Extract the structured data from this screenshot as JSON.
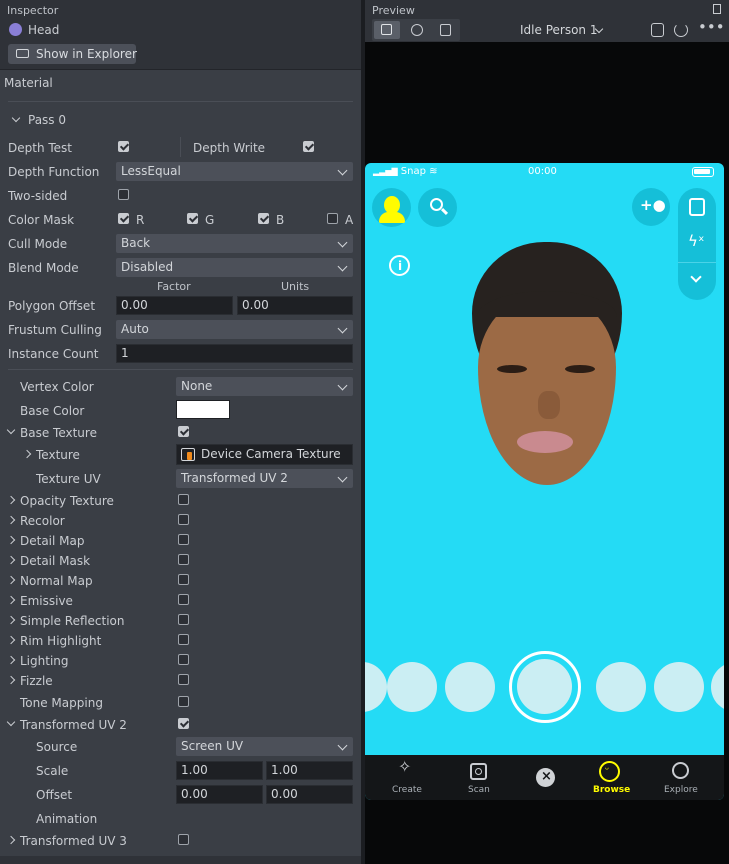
{
  "inspector": {
    "title": "Inspector",
    "object_name": "Head",
    "show_in_explorer": "Show in Explorer",
    "section": "Material",
    "pass": "Pass 0",
    "depth_test": {
      "label": "Depth Test",
      "checked": true
    },
    "depth_write": {
      "label": "Depth Write",
      "checked": true
    },
    "depth_function": {
      "label": "Depth Function",
      "value": "LessEqual"
    },
    "two_sided": {
      "label": "Two-sided",
      "checked": false
    },
    "color_mask": {
      "label": "Color Mask",
      "r": "R",
      "g": "G",
      "b": "B",
      "a": "A"
    },
    "cull_mode": {
      "label": "Cull Mode",
      "value": "Back"
    },
    "blend_mode": {
      "label": "Blend Mode",
      "value": "Disabled"
    },
    "polygon_offset": {
      "label": "Polygon Offset",
      "factor_header": "Factor",
      "units_header": "Units",
      "factor": "0.00",
      "units": "0.00"
    },
    "frustum_culling": {
      "label": "Frustum Culling",
      "value": "Auto"
    },
    "instance_count": {
      "label": "Instance Count",
      "value": "1"
    },
    "vertex_color": {
      "label": "Vertex Color",
      "value": "None"
    },
    "base_color": {
      "label": "Base Color",
      "color": "#ffffff"
    },
    "base_texture": {
      "label": "Base Texture",
      "checked": true
    },
    "texture": {
      "label": "Texture",
      "value": "Device Camera Texture"
    },
    "texture_uv": {
      "label": "Texture UV",
      "value": "Transformed UV 2"
    },
    "features": [
      {
        "label": "Opacity Texture",
        "expandable": true
      },
      {
        "label": "Recolor",
        "expandable": true
      },
      {
        "label": "Detail Map",
        "expandable": true
      },
      {
        "label": "Detail Mask",
        "expandable": true
      },
      {
        "label": "Normal Map",
        "expandable": true
      },
      {
        "label": "Emissive",
        "expandable": true
      },
      {
        "label": "Simple Reflection",
        "expandable": true
      },
      {
        "label": "Rim Highlight",
        "expandable": true
      },
      {
        "label": "Lighting",
        "expandable": true
      },
      {
        "label": "Fizzle",
        "expandable": true
      },
      {
        "label": "Tone Mapping",
        "expandable": false
      }
    ],
    "transformed_uv2": {
      "label": "Transformed UV 2",
      "checked": true,
      "source_label": "Source",
      "source_value": "Screen UV",
      "scale_label": "Scale",
      "scale_x": "1.00",
      "scale_y": "1.00",
      "offset_label": "Offset",
      "offset_x": "0.00",
      "offset_y": "0.00",
      "animation_label": "Animation"
    },
    "transformed_uv3": {
      "label": "Transformed UV 3",
      "checked": false
    }
  },
  "preview": {
    "title": "Preview",
    "person_select": "Idle Person 1",
    "status": {
      "carrier": "Snap",
      "time": "00:00"
    },
    "nav": [
      "Create",
      "Scan",
      "Browse",
      "Explore"
    ],
    "accent": "#24dbf5",
    "browse_color": "#fffc00"
  }
}
